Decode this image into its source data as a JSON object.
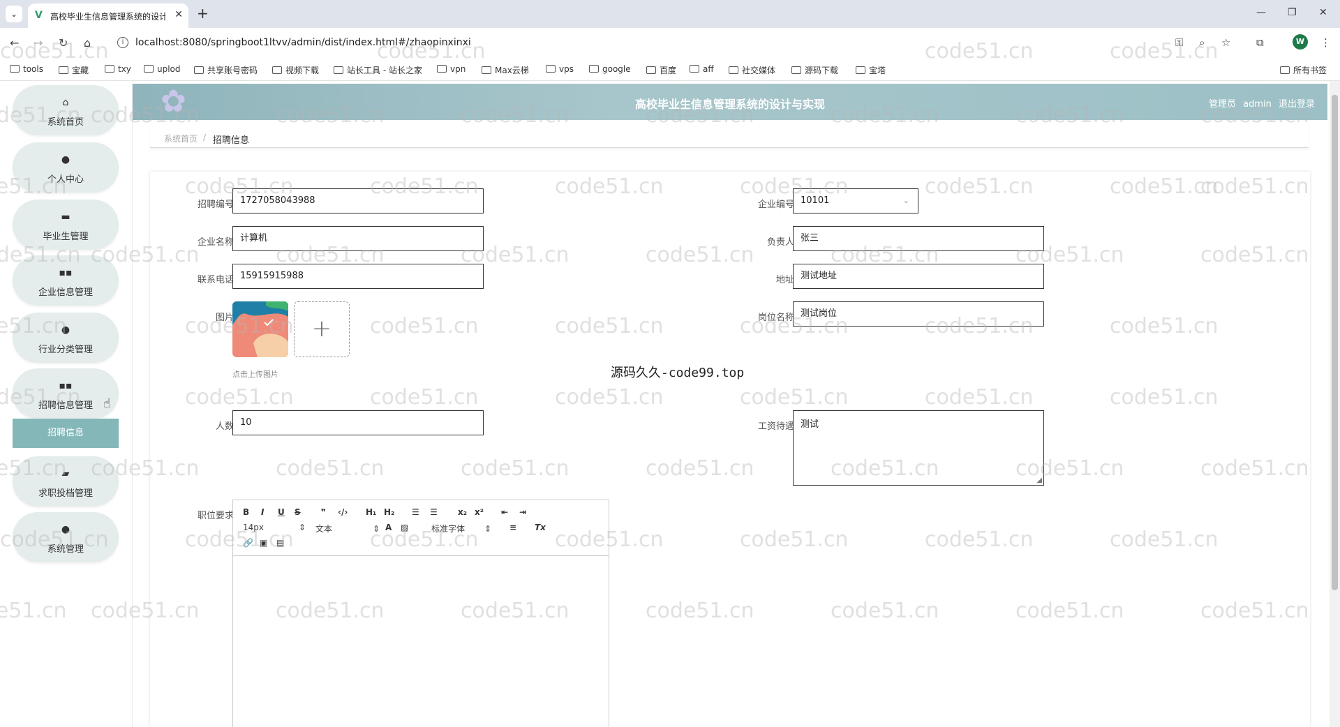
{
  "browser": {
    "tab_title": "高校毕业生信息管理系统的设计",
    "url": "localhost:8080/springboot1ltvv/admin/dist/index.html#/zhaopinxinxi",
    "profile_initial": "W",
    "bookmarks": [
      "tools",
      "宝藏",
      "txy",
      "uplod",
      "共享账号密码",
      "视频下载",
      "站长工具 - 站长之家",
      "vpn",
      "Max云梯",
      "vps",
      "google",
      "百度",
      "aff",
      "社交媒体",
      "源码下载",
      "宝塔"
    ],
    "bookmarks_all": "所有书签"
  },
  "header": {
    "title": "高校毕业生信息管理系统的设计与实现",
    "user_role": "管理员",
    "username": "admin",
    "logout": "退出登录"
  },
  "sidebar": {
    "items": [
      {
        "label": "系统首页",
        "icon": "home-icon"
      },
      {
        "label": "个人中心",
        "icon": "user-icon"
      },
      {
        "label": "毕业生管理",
        "icon": "book-icon"
      },
      {
        "label": "企业信息管理",
        "icon": "grid-icon"
      },
      {
        "label": "行业分类管理",
        "icon": "pin-icon"
      },
      {
        "label": "招聘信息管理",
        "icon": "grid-icon"
      },
      {
        "label": "求职投档管理",
        "icon": "briefcase-icon"
      },
      {
        "label": "系统管理",
        "icon": "user-icon"
      }
    ],
    "active_sub": "招聘信息"
  },
  "breadcrumb": {
    "home": "系统首页",
    "current": "招聘信息"
  },
  "form": {
    "zhaopin_no": {
      "label": "招聘编号",
      "value": "1727058043988"
    },
    "company_no": {
      "label": "企业编号",
      "value": "10101"
    },
    "company_name": {
      "label": "企业名称",
      "value": "计算机"
    },
    "contact_person": {
      "label": "负责人",
      "value": "张三"
    },
    "phone": {
      "label": "联系电话",
      "value": "15915915988"
    },
    "address": {
      "label": "地址",
      "value": "测试地址"
    },
    "image": {
      "label": "图片",
      "upload_tip": "点击上传图片"
    },
    "position": {
      "label": "岗位名称",
      "value": "测试岗位"
    },
    "headcount": {
      "label": "人数",
      "value": "10"
    },
    "salary": {
      "label": "工资待遇",
      "value": "测试"
    },
    "requirements": {
      "label": "职位要求"
    }
  },
  "editor_toolbar": {
    "font_size": "14px",
    "text_style": "文本",
    "font_family": "标准字体"
  },
  "overlay_text": "源码久久-code99.top",
  "watermark": "code51.cn"
}
